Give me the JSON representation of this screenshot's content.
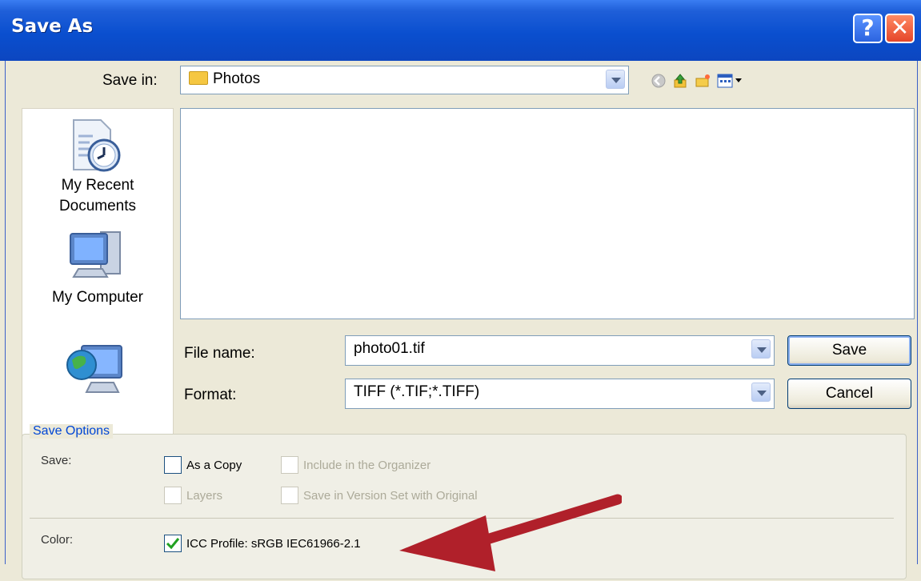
{
  "window": {
    "title": "Save As"
  },
  "toolbar": {
    "save_in_label": "Save in:",
    "save_in_value": "Photos"
  },
  "places": [
    {
      "label_line1": "My Recent",
      "label_line2": "Documents",
      "icon": "recent-documents-icon"
    },
    {
      "label": "My Computer",
      "icon": "computer-icon"
    },
    {
      "label": "",
      "icon": "network-icon"
    }
  ],
  "file": {
    "name_label": "File name:",
    "name_value": "photo01.tif",
    "format_label": "Format:",
    "format_value": "TIFF (*.TIF;*.TIFF)"
  },
  "buttons": {
    "save": "Save",
    "cancel": "Cancel"
  },
  "options": {
    "group_title": "Save Options",
    "save_label": "Save:",
    "as_copy": "As a Copy",
    "include_organizer": "Include in the Organizer",
    "layers": "Layers",
    "version_set": "Save in Version Set with Original",
    "color_label": "Color:",
    "icc_profile": "ICC Profile:  sRGB IEC61966-2.1"
  },
  "colors": {
    "titlebar": "#0a4fcf",
    "annotation_arrow": "#b0202a"
  }
}
